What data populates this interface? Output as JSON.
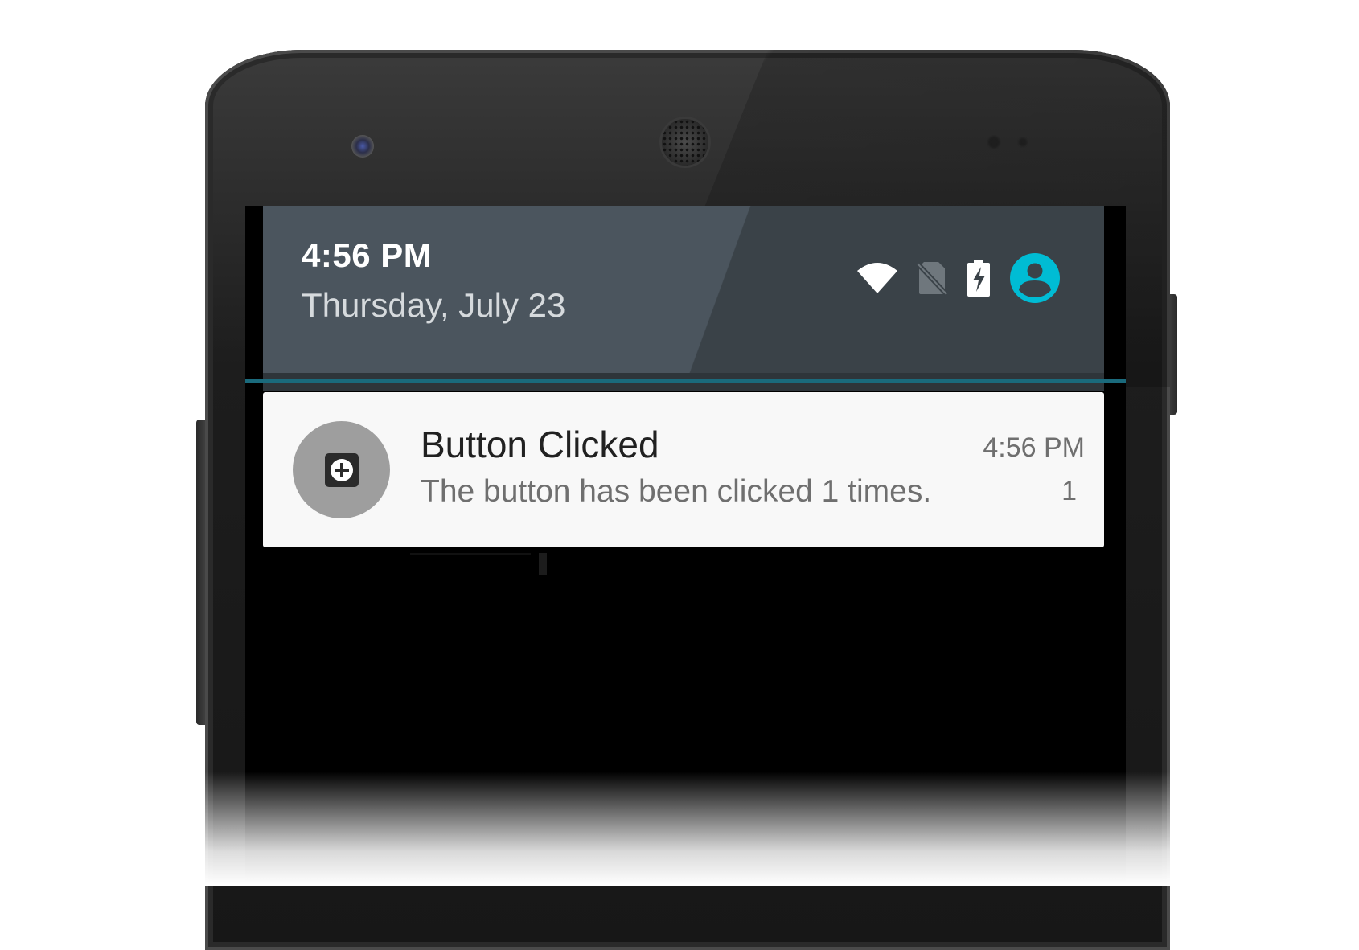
{
  "status_header": {
    "time": "4:56 PM",
    "date": "Thursday, July 23",
    "icons": [
      "wifi-icon",
      "no-sim-icon",
      "battery-charging-icon",
      "user-account-icon"
    ],
    "accent_color": "#00bcd4"
  },
  "notification": {
    "title": "Button Clicked",
    "text": "The button has been clicked 1 times.",
    "time": "4:56 PM",
    "count": "1",
    "icon": "add-box-icon"
  }
}
